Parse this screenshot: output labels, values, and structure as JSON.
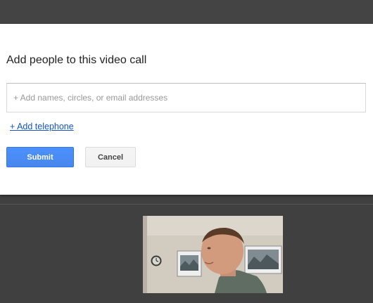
{
  "dialog": {
    "title": "Add people to this video call",
    "input_placeholder": "+ Add names, circles, or email addresses",
    "input_value": "",
    "add_telephone_label": "+ Add telephone",
    "submit_label": "Submit",
    "cancel_label": "Cancel"
  },
  "video": {
    "icon": "self-video-preview"
  },
  "colors": {
    "accent": "#4d90fe",
    "link": "#1155cc",
    "background": "#404040"
  }
}
